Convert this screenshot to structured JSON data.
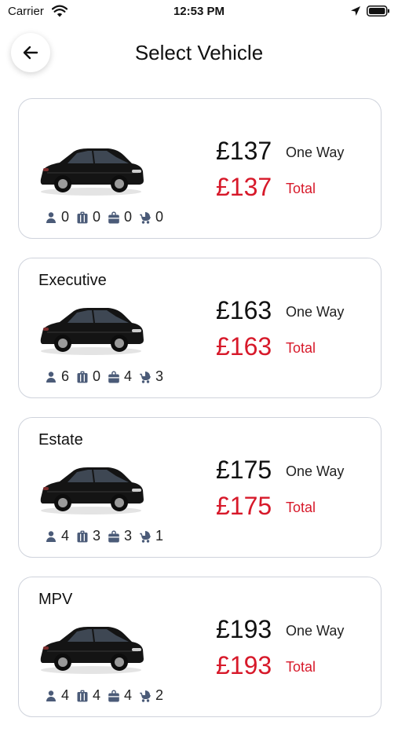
{
  "status_bar": {
    "carrier": "Carrier",
    "time": "12:53 PM"
  },
  "header": {
    "title": "Select Vehicle"
  },
  "colors": {
    "total_price": "#d7192a",
    "icon": "#4b5b78"
  },
  "icons": {
    "passengers": "person-icon",
    "suitcases": "suitcase-icon",
    "bags": "bag-icon",
    "child_seats": "stroller-icon"
  },
  "vehicles": [
    {
      "name": "",
      "image": "black-saloon-car",
      "price": "£137",
      "price_label": "One Way",
      "total": "£137",
      "total_label": "Total",
      "passengers": "0",
      "suitcases": "0",
      "bags": "0",
      "child_seats": "0"
    },
    {
      "name": "Executive",
      "image": "black-executive-car",
      "price": "£163",
      "price_label": "One Way",
      "total": "£163",
      "total_label": "Total",
      "passengers": "6",
      "suitcases": "0",
      "bags": "4",
      "child_seats": "3"
    },
    {
      "name": "Estate",
      "image": "black-estate-car",
      "price": "£175",
      "price_label": "One Way",
      "total": "£175",
      "total_label": "Total",
      "passengers": "4",
      "suitcases": "3",
      "bags": "3",
      "child_seats": "1"
    },
    {
      "name": "MPV",
      "image": "black-mpv-car",
      "price": "£193",
      "price_label": "One Way",
      "total": "£193",
      "total_label": "Total",
      "passengers": "4",
      "suitcases": "4",
      "bags": "4",
      "child_seats": "2"
    }
  ]
}
